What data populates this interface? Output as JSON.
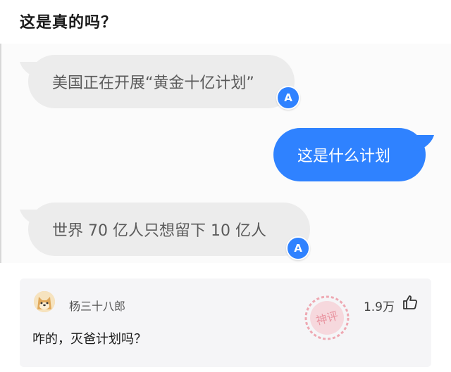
{
  "post": {
    "title": "这是真的吗？"
  },
  "chat": {
    "messages": [
      {
        "side": "left",
        "text": "美国正在开展“黄金十亿计划”",
        "avatar_letter": "A"
      },
      {
        "side": "right",
        "text": "这是什么计划"
      },
      {
        "side": "left",
        "text": "世界 70 亿人只想留下 10 亿人",
        "avatar_letter": "A"
      }
    ],
    "colors": {
      "incoming": "#ececec",
      "outgoing": "#2f82ff"
    }
  },
  "comment": {
    "username": "杨三十八郎",
    "likes": "1.9万",
    "text": "咋的，灭爸计划吗？",
    "stamp_text": "神评",
    "icons": {
      "avatar": "doge-avatar-icon",
      "like": "thumbs-up-icon"
    }
  }
}
